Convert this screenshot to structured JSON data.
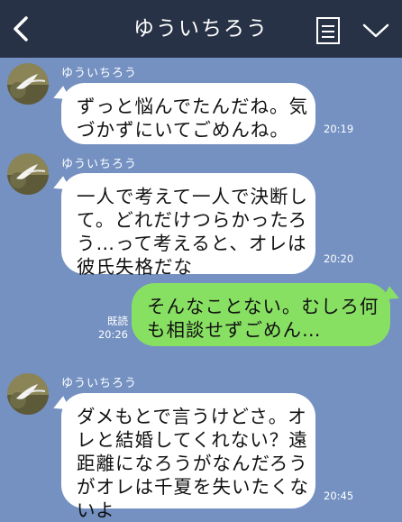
{
  "header": {
    "title": "ゆういちろう",
    "back_icon": "chevron-left-icon",
    "memo_icon": "notes-icon",
    "menu_icon": "chevron-down-icon",
    "background": "#273246"
  },
  "chat": {
    "background": "#7491c2",
    "incoming_bubble_color": "#ffffff",
    "outgoing_bubble_color": "#88e063",
    "messages": [
      {
        "sender": "ゆういちろう",
        "lines": [
          "ずっと悩んでたんだね。気",
          "づかずにいてごめんね。"
        ],
        "time": "20:19"
      },
      {
        "sender": "ゆういちろう",
        "lines": [
          "一人で考えて一人で決断し",
          "て。どれだけつらかったろ",
          "う…って考えると、オレは",
          "彼氏失格だな"
        ],
        "time": "20:20"
      },
      {
        "lines": [
          "そんなことない。むしろ何",
          "も相談せずごめん…"
        ],
        "read": "既読",
        "time": "20:26"
      },
      {
        "sender": "ゆういちろう",
        "lines": [
          "ダメもとで言うけどさ。オ",
          "レと結婚してくれない？遠",
          "距離になろうがなんだろう",
          "がオレは千夏を失いたくな",
          "いよ"
        ],
        "time": "20:45"
      }
    ]
  }
}
